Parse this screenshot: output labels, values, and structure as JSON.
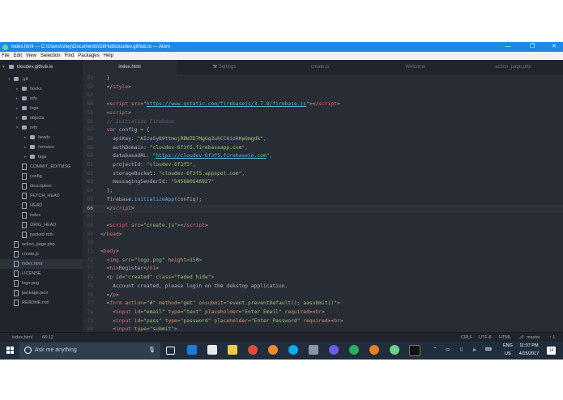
{
  "window": {
    "title": "index.html — C:\\Users\\rzley\\Documents\\GitHub\\cloudev.github.io — Atom",
    "minimize": "—",
    "maximize": "❐",
    "close": "✕"
  },
  "menu": [
    "File",
    "Edit",
    "View",
    "Selection",
    "Find",
    "Packages",
    "Help"
  ],
  "tree_root": "cloudev.github.io",
  "tabs": [
    {
      "label": "index.html",
      "active": true
    },
    {
      "label": "Settings",
      "active": false
    },
    {
      "label": "create.js",
      "active": false
    },
    {
      "label": "Welcome",
      "active": false
    },
    {
      "label": "action_page.php",
      "active": false
    }
  ],
  "tree": [
    {
      "label": ".git",
      "type": "folder",
      "depth": 1,
      "arrow": "▾"
    },
    {
      "label": "hooks",
      "type": "folder",
      "depth": 2,
      "arrow": "▸"
    },
    {
      "label": "info",
      "type": "folder",
      "depth": 2,
      "arrow": "▸"
    },
    {
      "label": "logs",
      "type": "folder",
      "depth": 2,
      "arrow": "▸"
    },
    {
      "label": "objects",
      "type": "folder",
      "depth": 2,
      "arrow": "▸"
    },
    {
      "label": "refs",
      "type": "folder",
      "depth": 2,
      "arrow": "▾"
    },
    {
      "label": "heads",
      "type": "folder",
      "depth": 3,
      "arrow": "▸"
    },
    {
      "label": "remotes",
      "type": "folder",
      "depth": 3,
      "arrow": "▸"
    },
    {
      "label": "tags",
      "type": "folder",
      "depth": 3,
      "arrow": "▸"
    },
    {
      "label": "COMMIT_EDITMSG",
      "type": "file",
      "depth": 2,
      "arrow": ""
    },
    {
      "label": "config",
      "type": "file",
      "depth": 2,
      "arrow": ""
    },
    {
      "label": "description",
      "type": "file",
      "depth": 2,
      "arrow": ""
    },
    {
      "label": "FETCH_HEAD",
      "type": "file",
      "depth": 2,
      "arrow": ""
    },
    {
      "label": "HEAD",
      "type": "file",
      "depth": 2,
      "arrow": ""
    },
    {
      "label": "index",
      "type": "file",
      "depth": 2,
      "arrow": ""
    },
    {
      "label": "ORIG_HEAD",
      "type": "file",
      "depth": 2,
      "arrow": ""
    },
    {
      "label": "packed-refs",
      "type": "file",
      "depth": 2,
      "arrow": ""
    },
    {
      "label": "action_page.php",
      "type": "file",
      "depth": 1,
      "arrow": ""
    },
    {
      "label": "create.js",
      "type": "file",
      "depth": 1,
      "arrow": ""
    },
    {
      "label": "index.html",
      "type": "file",
      "depth": 1,
      "arrow": "",
      "selected": true
    },
    {
      "label": "LICENSE",
      "type": "file",
      "depth": 1,
      "arrow": ""
    },
    {
      "label": "logo.png",
      "type": "file",
      "depth": 1,
      "arrow": ""
    },
    {
      "label": "package.json",
      "type": "file",
      "depth": 1,
      "arrow": ""
    },
    {
      "label": "README.md",
      "type": "file",
      "depth": 1,
      "arrow": ""
    }
  ],
  "code": [
    {
      "n": "51",
      "t": [
        [
          "plain",
          "  }"
        ]
      ]
    },
    {
      "n": "52",
      "t": [
        [
          "plain",
          "  </"
        ],
        [
          "tag",
          "style"
        ],
        [
          "plain",
          ">"
        ]
      ]
    },
    {
      "n": "53",
      "t": []
    },
    {
      "n": "54",
      "t": [
        [
          "plain",
          "  <"
        ],
        [
          "tag",
          "script"
        ],
        [
          "attr",
          " src"
        ],
        [
          "plain",
          "=\""
        ],
        [
          "url",
          "https://www.gstatic.com/firebasejs/3.7.8/firebase.js"
        ],
        [
          "plain",
          "\"></"
        ],
        [
          "tag",
          "script"
        ],
        [
          "plain",
          ">"
        ]
      ]
    },
    {
      "n": "55",
      "t": [
        [
          "plain",
          "  <"
        ],
        [
          "tag",
          "script"
        ],
        [
          "plain",
          ">"
        ]
      ]
    },
    {
      "n": "56",
      "t": [
        [
          "com",
          "  // Initialize Firebase"
        ]
      ]
    },
    {
      "n": "57",
      "t": [
        [
          "kw",
          "  var"
        ],
        [
          "plain",
          " config = {"
        ]
      ]
    },
    {
      "n": "58",
      "t": [
        [
          "plain",
          "    apiKey: "
        ],
        [
          "str",
          "\"AIzaSyB9ttmojRBWZD7MgGq3uhCCAiokHpQmgdk\""
        ],
        [
          "plain",
          ","
        ]
      ]
    },
    {
      "n": "59",
      "t": [
        [
          "plain",
          "    authDomain: "
        ],
        [
          "str",
          "\"cloudev-6f3f5.firebaseapp.com\""
        ],
        [
          "plain",
          ","
        ]
      ]
    },
    {
      "n": "60",
      "t": [
        [
          "plain",
          "    databaseURL: "
        ],
        [
          "str",
          "\""
        ],
        [
          "url",
          "https://cloudev-6f3f5.firebaseio.com"
        ],
        [
          "str",
          "\""
        ],
        [
          "plain",
          ","
        ]
      ]
    },
    {
      "n": "61",
      "t": [
        [
          "plain",
          "    projectId: "
        ],
        [
          "str",
          "\"cloudev-6f3f5\""
        ],
        [
          "plain",
          ","
        ]
      ]
    },
    {
      "n": "62",
      "t": [
        [
          "plain",
          "    storageBucket: "
        ],
        [
          "str",
          "\"cloudev-6f3f5.appspot.com\""
        ],
        [
          "plain",
          ","
        ]
      ]
    },
    {
      "n": "63",
      "t": [
        [
          "plain",
          "    messagingSenderId: "
        ],
        [
          "str",
          "\"545680646927\""
        ]
      ]
    },
    {
      "n": "64",
      "t": [
        [
          "plain",
          "  };"
        ]
      ]
    },
    {
      "n": "65",
      "t": [
        [
          "plain",
          "  firebase."
        ],
        [
          "fn",
          "initializeApp"
        ],
        [
          "plain",
          "(config);"
        ]
      ]
    },
    {
      "n": "66",
      "t": [
        [
          "plain",
          "  </"
        ],
        [
          "tag",
          "script"
        ],
        [
          "plain",
          ">"
        ]
      ],
      "current": true
    },
    {
      "n": "67",
      "t": []
    },
    {
      "n": "68",
      "t": [
        [
          "plain",
          "  <"
        ],
        [
          "tag",
          "script"
        ],
        [
          "attr",
          " src"
        ],
        [
          "plain",
          "="
        ],
        [
          "str",
          "\"create.js\""
        ],
        [
          "plain",
          "></"
        ],
        [
          "tag",
          "script"
        ],
        [
          "plain",
          ">"
        ]
      ]
    },
    {
      "n": "69",
      "t": [
        [
          "plain",
          "</"
        ],
        [
          "tag",
          "head"
        ],
        [
          "plain",
          ">"
        ]
      ]
    },
    {
      "n": "70",
      "t": []
    },
    {
      "n": "71",
      "t": [
        [
          "plain",
          "<"
        ],
        [
          "tag",
          "body"
        ],
        [
          "plain",
          ">"
        ]
      ]
    },
    {
      "n": "72",
      "t": [
        [
          "plain",
          "  <"
        ],
        [
          "tag",
          "img"
        ],
        [
          "attr",
          " src"
        ],
        [
          "plain",
          "="
        ],
        [
          "str",
          "\"logo.png\""
        ],
        [
          "attr",
          " height"
        ],
        [
          "plain",
          "="
        ],
        [
          "str",
          "150"
        ],
        [
          "plain",
          ">"
        ]
      ]
    },
    {
      "n": "73",
      "t": [
        [
          "plain",
          "  <"
        ],
        [
          "tag",
          "h1"
        ],
        [
          "plain",
          ">Register</"
        ],
        [
          "tag",
          "h1"
        ],
        [
          "plain",
          ">"
        ]
      ]
    },
    {
      "n": "74",
      "t": [
        [
          "plain",
          "  <"
        ],
        [
          "tag",
          "p"
        ],
        [
          "attr",
          " id"
        ],
        [
          "plain",
          "="
        ],
        [
          "str",
          "\"created\""
        ],
        [
          "attr",
          " class"
        ],
        [
          "plain",
          "="
        ],
        [
          "str",
          "\"faded hide\""
        ],
        [
          "plain",
          ">"
        ]
      ]
    },
    {
      "n": "75",
      "t": [
        [
          "plain",
          "    Account created, please login on the dekstop application."
        ]
      ]
    },
    {
      "n": "76",
      "t": [
        [
          "plain",
          "  </"
        ],
        [
          "tag",
          "p"
        ],
        [
          "plain",
          ">"
        ]
      ]
    },
    {
      "n": "77",
      "t": [
        [
          "plain",
          "  <"
        ],
        [
          "tag",
          "form"
        ],
        [
          "attr",
          " action"
        ],
        [
          "plain",
          "="
        ],
        [
          "str",
          "\"#\""
        ],
        [
          "attr",
          " method"
        ],
        [
          "plain",
          "="
        ],
        [
          "str",
          "\"get\""
        ],
        [
          "attr",
          " onsubmit"
        ],
        [
          "plain",
          "="
        ],
        [
          "str",
          "\"event.preventDefault(); aasubmit()\""
        ],
        [
          "plain",
          ">"
        ]
      ]
    },
    {
      "n": "78",
      "t": [
        [
          "plain",
          "    <"
        ],
        [
          "tag",
          "input"
        ],
        [
          "attr",
          " id"
        ],
        [
          "plain",
          "="
        ],
        [
          "str",
          "\"email\""
        ],
        [
          "attr",
          " type"
        ],
        [
          "plain",
          "="
        ],
        [
          "str",
          "\"text\""
        ],
        [
          "attr",
          " placeholder"
        ],
        [
          "plain",
          "="
        ],
        [
          "str",
          "\"Enter Email\""
        ],
        [
          "attr",
          " required"
        ],
        [
          "plain",
          "><"
        ],
        [
          "tag",
          "br"
        ],
        [
          "plain",
          ">"
        ]
      ]
    },
    {
      "n": "79",
      "t": [
        [
          "plain",
          "    <"
        ],
        [
          "tag",
          "input"
        ],
        [
          "attr",
          " id"
        ],
        [
          "plain",
          "="
        ],
        [
          "str",
          "\"pass\""
        ],
        [
          "attr",
          " type"
        ],
        [
          "plain",
          "="
        ],
        [
          "str",
          "\"password\""
        ],
        [
          "attr",
          " placeholder"
        ],
        [
          "plain",
          "="
        ],
        [
          "str",
          "\"Enter Password\""
        ],
        [
          "attr",
          " required"
        ],
        [
          "plain",
          "><"
        ],
        [
          "tag",
          "br"
        ],
        [
          "plain",
          ">"
        ]
      ]
    },
    {
      "n": "80",
      "t": [
        [
          "plain",
          "    <"
        ],
        [
          "tag",
          "input"
        ],
        [
          "attr",
          " type"
        ],
        [
          "plain",
          "="
        ],
        [
          "str",
          "\"submit\""
        ],
        [
          "plain",
          ">"
        ]
      ]
    }
  ],
  "status": {
    "file": "index.html",
    "cursor": "66:12",
    "line_ending": "CRLF",
    "encoding": "UTF-8",
    "grammar": "HTML",
    "branch": "master",
    "push": "↑ 1"
  },
  "taskbar": {
    "search_placeholder": "Ask me anything",
    "lang": "ENG",
    "region": "US",
    "time": "11:07 PM",
    "date": "4/15/2017",
    "notif_count": "14"
  },
  "colors": {
    "titlebar": "#1e88e5",
    "editor_bg": "#282c34",
    "tree_bg": "#21252b",
    "taskbar_bg": "#1f2d3d"
  }
}
